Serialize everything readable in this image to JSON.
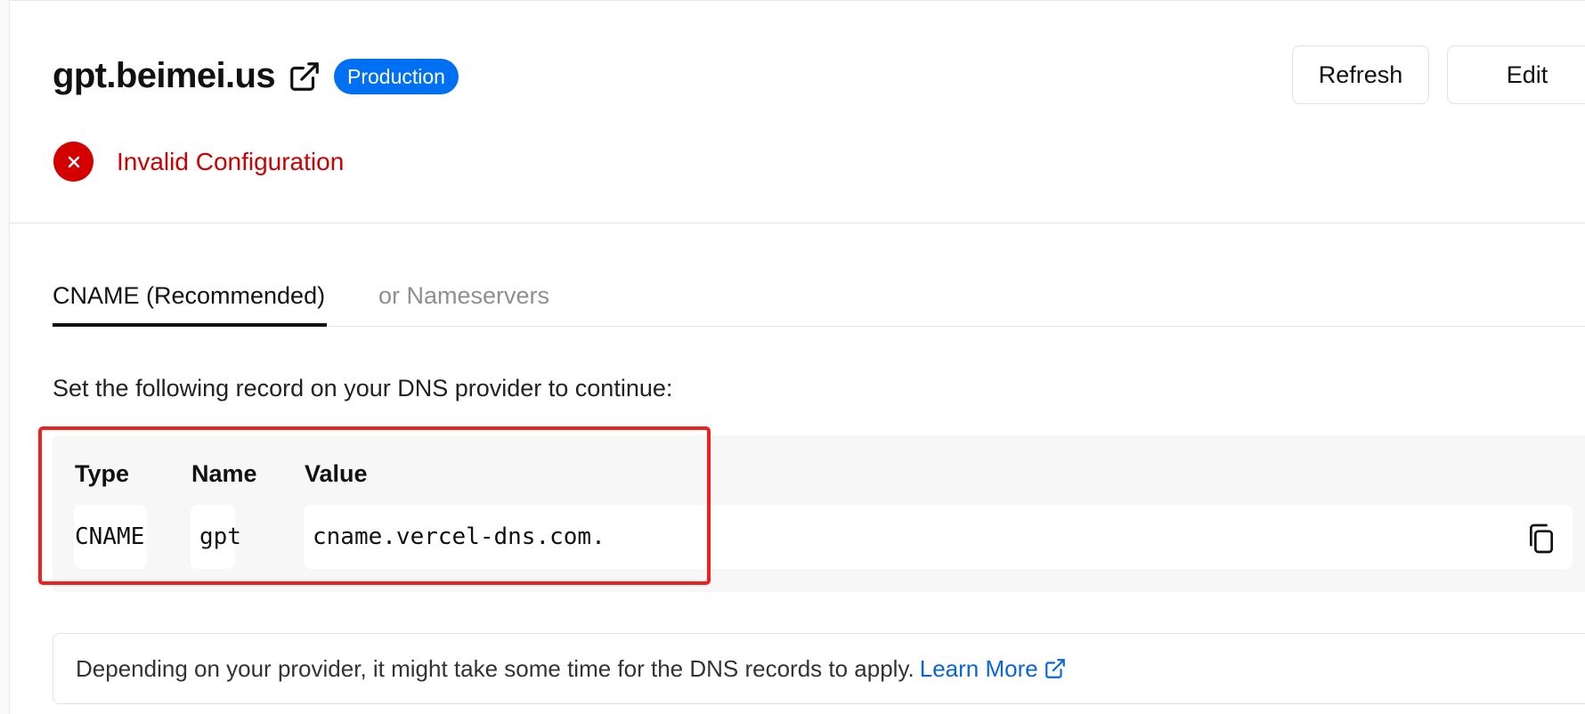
{
  "header": {
    "domain": "gpt.beimei.us",
    "badge": "Production",
    "refresh_label": "Refresh",
    "edit_label": "Edit"
  },
  "status": {
    "text": "Invalid Configuration",
    "icon": "error-x-icon",
    "color": "#cc0000"
  },
  "tabs": [
    {
      "label": "CNAME (Recommended)",
      "active": true
    },
    {
      "label": "or Nameservers",
      "active": false
    }
  ],
  "instructions": "Set the following record on your DNS provider to continue:",
  "record": {
    "headers": {
      "type": "Type",
      "name": "Name",
      "value": "Value"
    },
    "type": "CNAME",
    "name": "gpt",
    "value": "cname.vercel-dns.com."
  },
  "note": {
    "text": "Depending on your provider, it might take some time for the DNS records to apply.",
    "link_label": "Learn More"
  },
  "colors": {
    "accent": "#0070f3",
    "error": "#d40000",
    "highlight": "#f02020"
  }
}
